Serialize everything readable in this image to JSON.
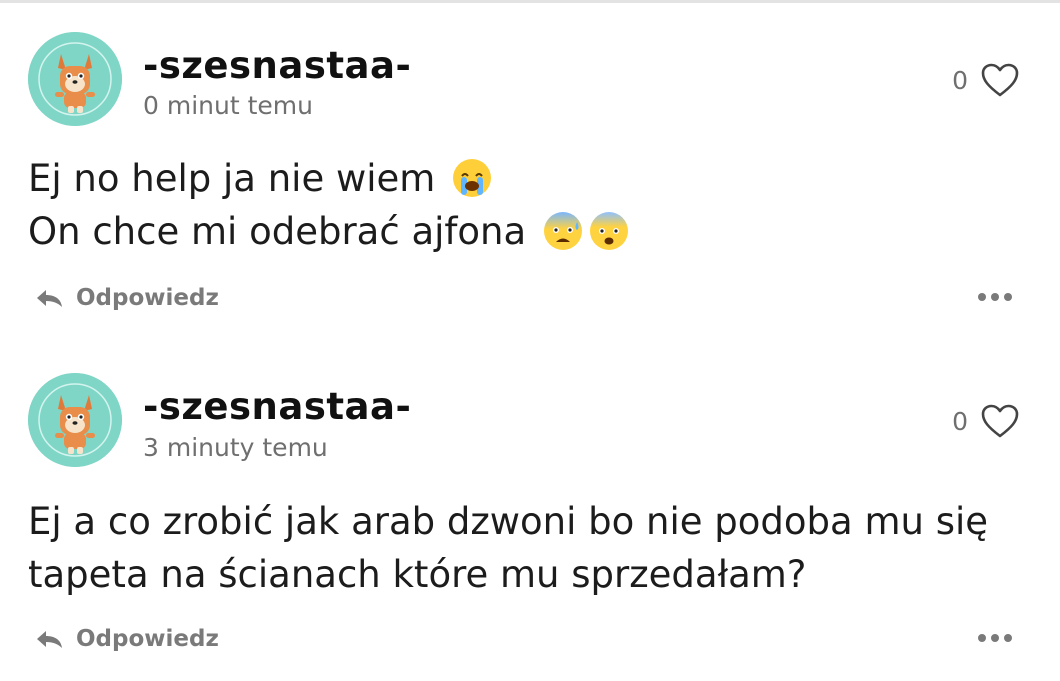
{
  "comments": [
    {
      "username": "-szesnastaa-",
      "time": "0 minut temu",
      "likes": "0",
      "lines": [
        {
          "text": "Ej no help ja nie wiem",
          "emojis": [
            "loudly-crying-face-emoji"
          ]
        },
        {
          "text": "On chce mi odebrać ajfona",
          "emojis": [
            "anxious-face-with-sweat-emoji",
            "fearful-face-emoji"
          ]
        }
      ],
      "reply_label": "Odpowiedz"
    },
    {
      "username": "-szesnastaa-",
      "time": "3 minuty temu",
      "likes": "0",
      "lines": [
        {
          "text": "Ej a co zrobić jak arab dzwoni bo nie podoba mu się",
          "emojis": []
        },
        {
          "text": "tapeta na ścianach które mu sprzedałam?",
          "emojis": []
        }
      ],
      "reply_label": "Odpowiedz"
    }
  ],
  "colors": {
    "avatar_bg": "#7fd6c6",
    "text": "#1c1c1c",
    "muted": "#6f6f6f"
  }
}
